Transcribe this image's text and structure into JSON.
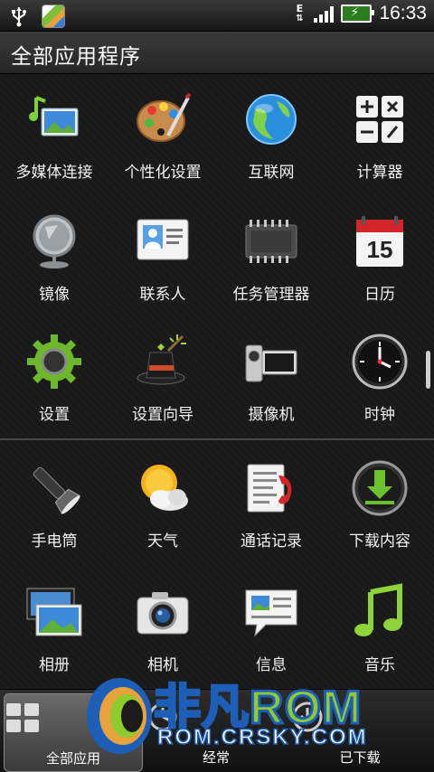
{
  "status_bar": {
    "time": "16:33",
    "data_indicator": "E",
    "battery_charging": true
  },
  "title_bar": {
    "title": "全部应用程序"
  },
  "apps": [
    {
      "label": "多媒体连接",
      "icon": "media-link-icon"
    },
    {
      "label": "个性化设置",
      "icon": "palette-icon"
    },
    {
      "label": "互联网",
      "icon": "globe-icon"
    },
    {
      "label": "计算器",
      "icon": "calculator-icon"
    },
    {
      "label": "镜像",
      "icon": "mirror-icon"
    },
    {
      "label": "联系人",
      "icon": "contacts-card-icon"
    },
    {
      "label": "任务管理器",
      "icon": "chip-icon"
    },
    {
      "label": "日历",
      "icon": "calendar-icon",
      "day": "15"
    },
    {
      "label": "设置",
      "icon": "gear-icon"
    },
    {
      "label": "设置向导",
      "icon": "magic-hat-icon"
    },
    {
      "label": "摄像机",
      "icon": "camcorder-icon"
    },
    {
      "label": "时钟",
      "icon": "clock-icon"
    },
    {
      "label": "手电筒",
      "icon": "flashlight-icon"
    },
    {
      "label": "天气",
      "icon": "weather-sun-cloud-icon"
    },
    {
      "label": "通话记录",
      "icon": "call-log-icon"
    },
    {
      "label": "下载内容",
      "icon": "download-icon"
    },
    {
      "label": "相册",
      "icon": "gallery-icon"
    },
    {
      "label": "相机",
      "icon": "camera-icon"
    },
    {
      "label": "信息",
      "icon": "message-icon"
    },
    {
      "label": "音乐",
      "icon": "music-note-icon"
    }
  ],
  "bottom_tabs": [
    {
      "label": "全部应用",
      "icon": "grid-icon",
      "selected": true
    },
    {
      "label": "经常",
      "icon": "frequent-icon",
      "selected": false
    },
    {
      "label": "已下载",
      "icon": "download-tab-icon",
      "selected": false
    }
  ],
  "watermark": {
    "brand": "非凡",
    "brand_rom": "ROM",
    "url": "ROM.CRSKY.COM"
  },
  "colors": {
    "accent_green": "#8ecb2e",
    "accent_blue": "#1d5fb8",
    "background": "#1b1b1b"
  }
}
